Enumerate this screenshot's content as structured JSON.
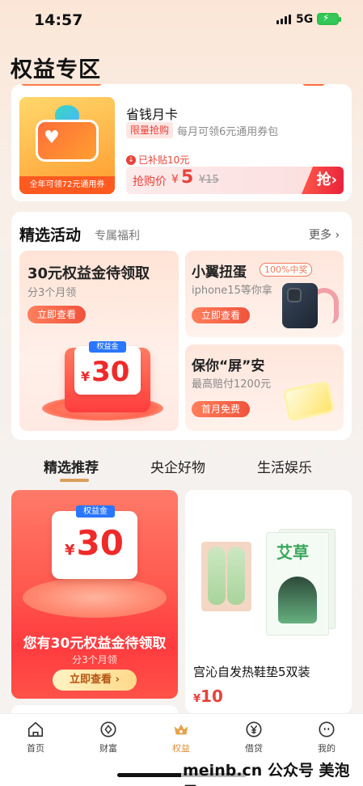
{
  "status_bar": {
    "time": "14:57",
    "network": "5G"
  },
  "page": {
    "title": "权益专区"
  },
  "product_card": {
    "image_caption": "全年可领72元通用券",
    "name": "省钱月卡",
    "limited_tag": "限量抢购",
    "description": "每月可领6元通用券包",
    "subsidy": "已补贴10元",
    "price_label": "抢购价",
    "currency": "¥",
    "price": "5",
    "original_price": "¥15",
    "buy_button": "抢"
  },
  "activities": {
    "title": "精选活动",
    "subtitle": "专属福利",
    "more": "更多",
    "big": {
      "title": "30元权益金待领取",
      "subtitle": "分3个月领",
      "button": "立即查看",
      "coin_label": "权益金",
      "coin_currency": "¥",
      "coin_value": "30"
    },
    "egg": {
      "title": "小翼扭蛋",
      "badge": "100%中奖",
      "subtitle": "iphone15等你拿",
      "button": "立即查看"
    },
    "screen": {
      "title": "保你“屏”安",
      "subtitle": "最高赔付1200元",
      "button": "首月免费"
    }
  },
  "tabs": [
    {
      "label": "精选推荐"
    },
    {
      "label": "央企好物"
    },
    {
      "label": "生活娱乐"
    }
  ],
  "promo": {
    "coin_label": "权益金",
    "currency": "¥",
    "value": "30",
    "title": "您有30元权益金待领取",
    "subtitle": "分3个月领",
    "button": "立即查看 ›"
  },
  "recommend_product": {
    "name": "宫沁自发热鞋垫5双装",
    "currency": "¥",
    "price": "10",
    "pack_text": "艾草"
  },
  "bottom_nav": [
    {
      "label": "首页",
      "icon": "home-icon"
    },
    {
      "label": "财富",
      "icon": "wealth-icon"
    },
    {
      "label": "权益",
      "icon": "crown-icon"
    },
    {
      "label": "借贷",
      "icon": "loan-icon"
    },
    {
      "label": "我的",
      "icon": "profile-icon"
    }
  ],
  "watermark": "meinb.cn 公众号 美泡君",
  "colors": {
    "accent": "#e8423a",
    "gold": "#d9a05b"
  }
}
